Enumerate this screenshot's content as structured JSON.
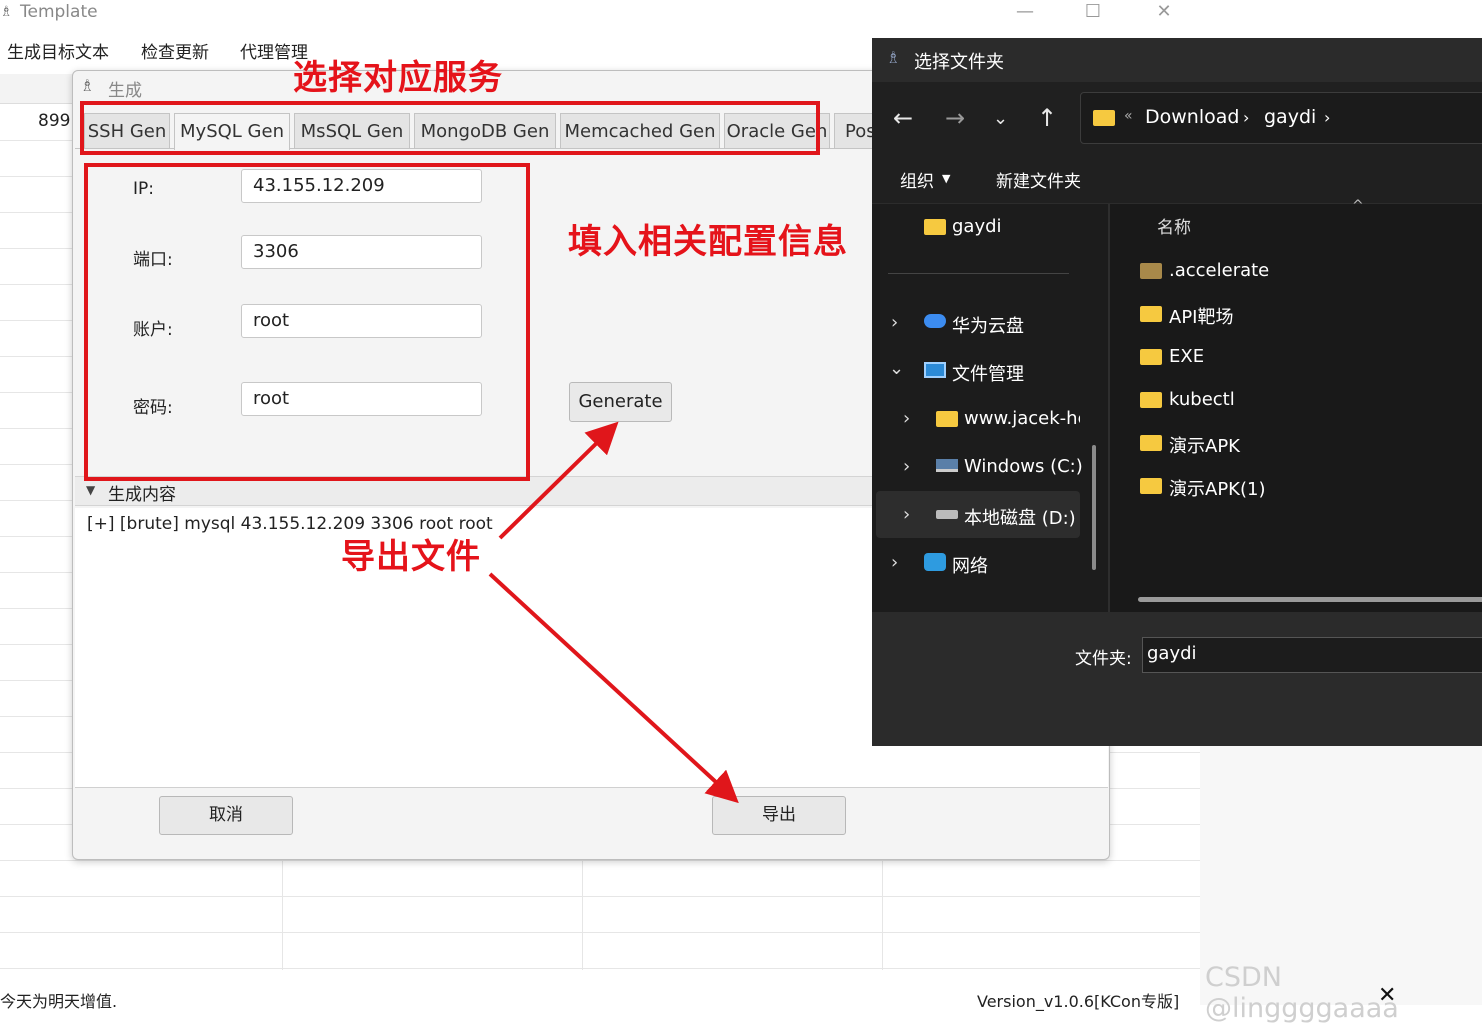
{
  "main_window": {
    "title": "Template",
    "menu": [
      "生成目标文本",
      "检查更新",
      "代理管理"
    ],
    "grid_value": "899",
    "status_left": "今天为明天增值.",
    "status_right": "Version_v1.0.6[KCon专版]"
  },
  "generator": {
    "title": "生成",
    "tabs": [
      "SSH Gen",
      "MySQL Gen",
      "MsSQL Gen",
      "MongoDB Gen",
      "Memcached Gen",
      "Oracle Gen",
      "Pos"
    ],
    "active_tab": "MySQL Gen",
    "form": {
      "ip_label": "IP:",
      "ip_value": "43.155.12.209",
      "port_label": "端口:",
      "port_value": "3306",
      "account_label": "账户:",
      "account_value": "root",
      "password_label": "密码:",
      "password_value": "root"
    },
    "generate_label": "Generate",
    "output_title": "生成内容",
    "output_line": "[+] [brute] mysql 43.155.12.209 3306 root root",
    "cancel_label": "取消",
    "export_label": "导出"
  },
  "annotations": {
    "select_service": "选择对应服务",
    "fill_config": "填入相关配置信息",
    "export_file": "导出文件",
    "color": "#e0161b"
  },
  "folder_dialog": {
    "title": "选择文件夹",
    "address": [
      "Download",
      "gaydi"
    ],
    "toolbar": {
      "organize": "组织",
      "new_folder": "新建文件夹"
    },
    "nav": {
      "quick": "gaydi",
      "items": [
        "华为云盘",
        "文件管理",
        "www.jacek-hc",
        "Windows (C:)",
        "本地磁盘 (D:)",
        "网络"
      ]
    },
    "column_name": "名称",
    "files": [
      ".accelerate",
      "API靶场",
      "EXE",
      "kubectl",
      "演示APK",
      "演示APK(1)"
    ],
    "folder_label": "文件夹:",
    "folder_value": "gaydi"
  },
  "watermark": "CSDN @linggggaaaa"
}
